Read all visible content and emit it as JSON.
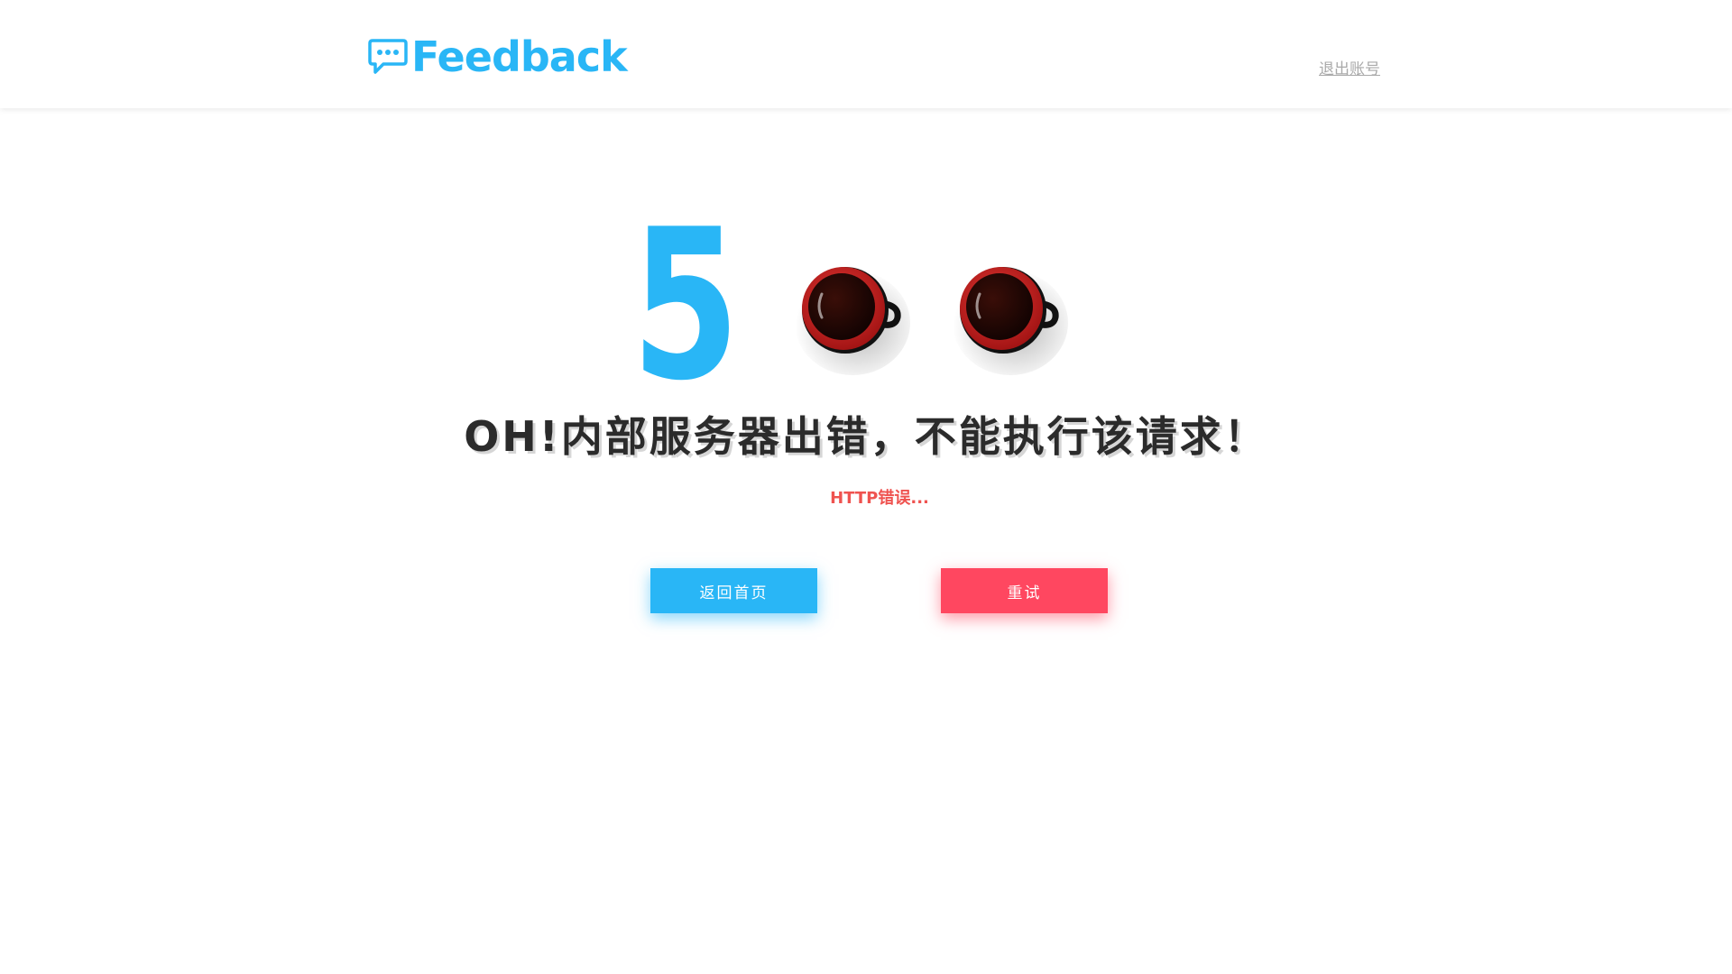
{
  "header": {
    "logo_text": "Feedback",
    "logout_label": "退出账号"
  },
  "error": {
    "code_digit": "5",
    "headline": "OH!内部服务器出错，不能执行该请求！",
    "detail": "HTTP错误..."
  },
  "actions": {
    "home_label": "返回首页",
    "retry_label": "重试"
  },
  "colors": {
    "brand_blue": "#29b6f6",
    "error_red": "#ef5350",
    "retry_pink": "#ff4760",
    "headline_text": "#2b2b2b",
    "logout_gray": "#a9a9a9"
  },
  "icons": {
    "logo": "speech-bubble-icon",
    "zeros": "coffee-cup-icon"
  }
}
